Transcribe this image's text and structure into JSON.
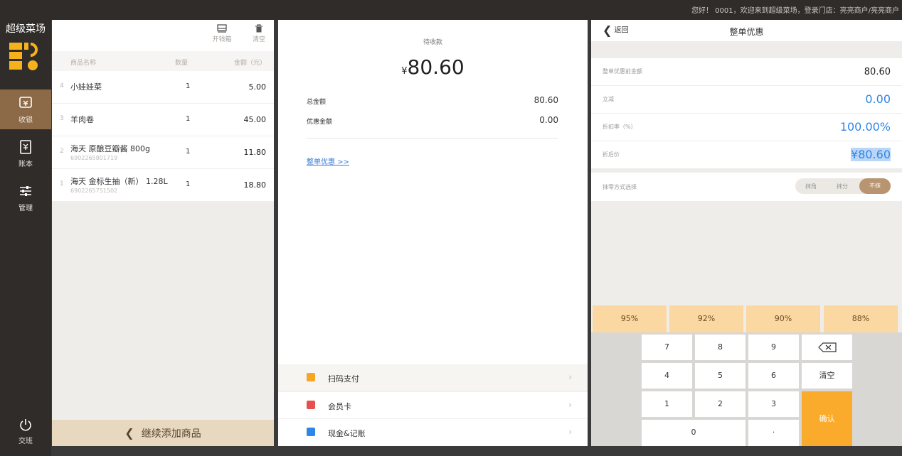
{
  "header": {
    "greeting": "您好！ 0001，欢迎来到超级菜场，登录门店：亮亮商户/亮亮商户"
  },
  "sidebar": {
    "brand": "超级菜场",
    "items": [
      {
        "label": "收银",
        "icon": "cashier-icon"
      },
      {
        "label": "账本",
        "icon": "ledger-icon"
      },
      {
        "label": "管理",
        "icon": "settings-sliders-icon"
      }
    ],
    "logout_label": "交班"
  },
  "cart": {
    "toolbar": {
      "open_drawer": "开钱箱",
      "clear": "清空"
    },
    "columns": {
      "name": "商品名称",
      "qty": "数量",
      "amount": "金额（元）"
    },
    "items": [
      {
        "index": "4",
        "name": "小娃娃菜",
        "code": "",
        "qty": "1",
        "amount": "5.00"
      },
      {
        "index": "3",
        "name": "羊肉卷",
        "code": "",
        "qty": "1",
        "amount": "45.00"
      },
      {
        "index": "2",
        "name": "海天 原酿豆瓣酱 800g",
        "code": "6902265801719",
        "qty": "1",
        "amount": "11.80"
      },
      {
        "index": "1",
        "name": "海天 金标生抽（新） 1.28L",
        "code": "6902265751502",
        "qty": "1",
        "amount": "18.80"
      }
    ],
    "add_more": "继续添加商品"
  },
  "payment": {
    "pending_label": "待收款",
    "currency": "¥",
    "pending_amount": "80.60",
    "total_label": "总金额",
    "total_value": "80.60",
    "discount_label": "优惠金额",
    "discount_value": "0.00",
    "whole_discount_link": "整单优惠 >>",
    "options": [
      {
        "label": "扫码支付",
        "color": "#f5a623"
      },
      {
        "label": "会员卡",
        "color": "#e94e4e"
      },
      {
        "label": "现金&记账",
        "color": "#2f86e6"
      }
    ]
  },
  "discount_panel": {
    "back_label": "返回",
    "title": "整单优惠",
    "fields": [
      {
        "label": "整单优惠前金额",
        "value": "80.60"
      },
      {
        "label": "立减",
        "value": "0.00"
      },
      {
        "label": "折扣率（%）",
        "value": "100.00%"
      },
      {
        "label": "折后价",
        "value": "¥80.60"
      }
    ],
    "rounding_label": "抹零方式选择",
    "rounding_options": [
      "抹角",
      "抹分",
      "不抹"
    ],
    "rounding_selected": "不抹",
    "quick_discounts": [
      "95%",
      "92%",
      "90%",
      "88%"
    ],
    "keys": [
      "7",
      "8",
      "9",
      "4",
      "5",
      "6",
      "1",
      "2",
      "3",
      "0",
      "·"
    ],
    "clear_key": "清空",
    "confirm_key": "确认",
    "accent": "#fbab2b"
  }
}
